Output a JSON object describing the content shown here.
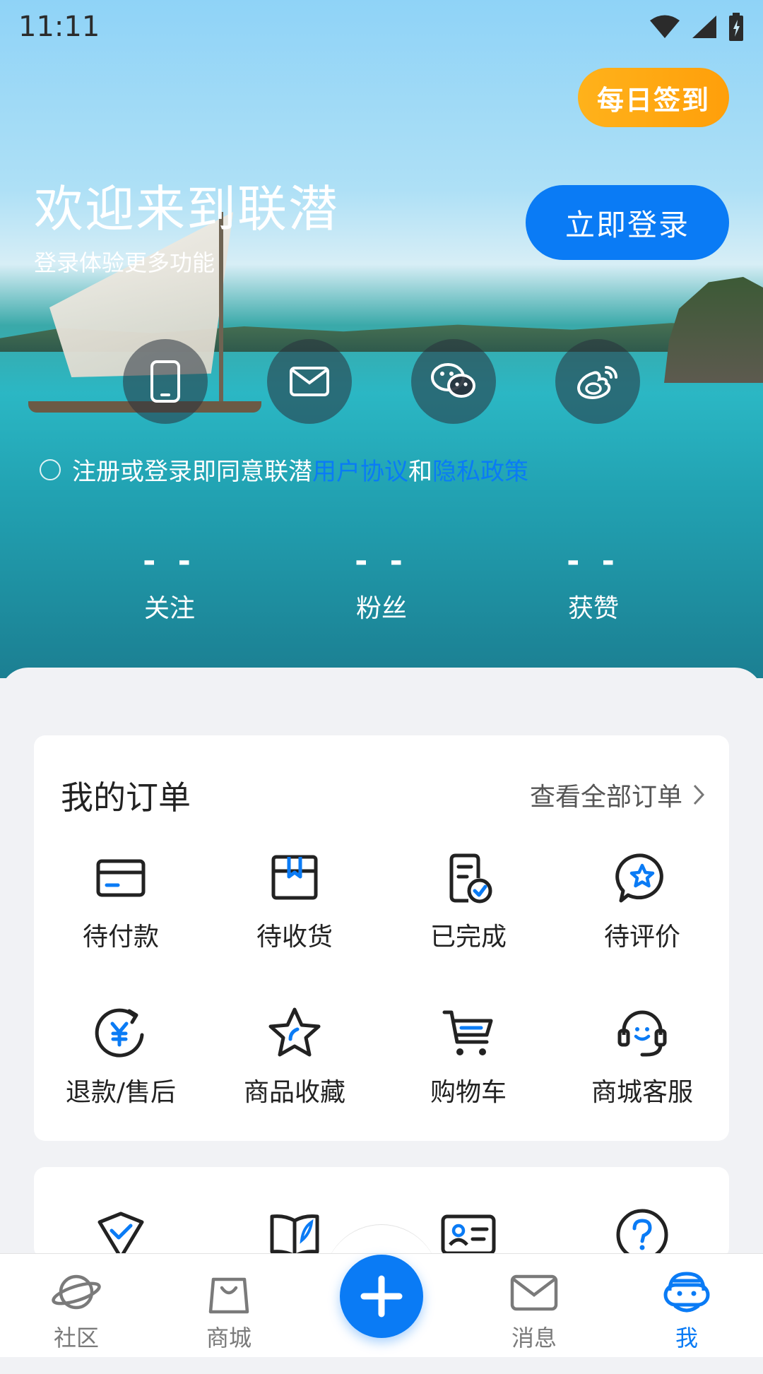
{
  "status_bar": {
    "time": "11:11"
  },
  "header": {
    "signin_label": "每日签到",
    "welcome_title": "欢迎来到联潜",
    "welcome_subtitle": "登录体验更多功能",
    "login_label": "立即登录"
  },
  "login_methods": [
    {
      "icon": "phone-icon"
    },
    {
      "icon": "mail-icon"
    },
    {
      "icon": "wechat-icon"
    },
    {
      "icon": "weibo-icon"
    }
  ],
  "agreement": {
    "prefix": "注册或登录即同意联潜",
    "user_agreement": "用户协议",
    "and": "和",
    "privacy_policy": "隐私政策"
  },
  "stats": [
    {
      "value": "- -",
      "label": "关注"
    },
    {
      "value": "- -",
      "label": "粉丝"
    },
    {
      "value": "- -",
      "label": "获赞"
    }
  ],
  "orders": {
    "title": "我的订单",
    "more_label": "查看全部订单",
    "items": [
      {
        "label": "待付款",
        "icon": "card-icon"
      },
      {
        "label": "待收货",
        "icon": "box-icon"
      },
      {
        "label": "已完成",
        "icon": "done-document-icon"
      },
      {
        "label": "待评价",
        "icon": "star-chat-icon"
      },
      {
        "label": "退款/售后",
        "icon": "yuan-refund-icon"
      },
      {
        "label": "商品收藏",
        "icon": "star-icon"
      },
      {
        "label": "购物车",
        "icon": "cart-icon"
      },
      {
        "label": "商城客服",
        "icon": "headset-icon"
      }
    ]
  },
  "tools": {
    "icons": [
      "shield-check-icon",
      "book-icon",
      "id-card-icon",
      "help-icon"
    ]
  },
  "tabbar": {
    "items": [
      {
        "label": "社区",
        "icon": "planet-icon"
      },
      {
        "label": "商城",
        "icon": "bag-icon"
      },
      {
        "label": "消息",
        "icon": "message-icon"
      },
      {
        "label": "我",
        "icon": "robot-icon"
      }
    ],
    "fab_icon": "plus-icon",
    "active_color": "#0a7bf5"
  },
  "colors": {
    "primary": "#0a7bf5",
    "signin": "#ffa812"
  }
}
